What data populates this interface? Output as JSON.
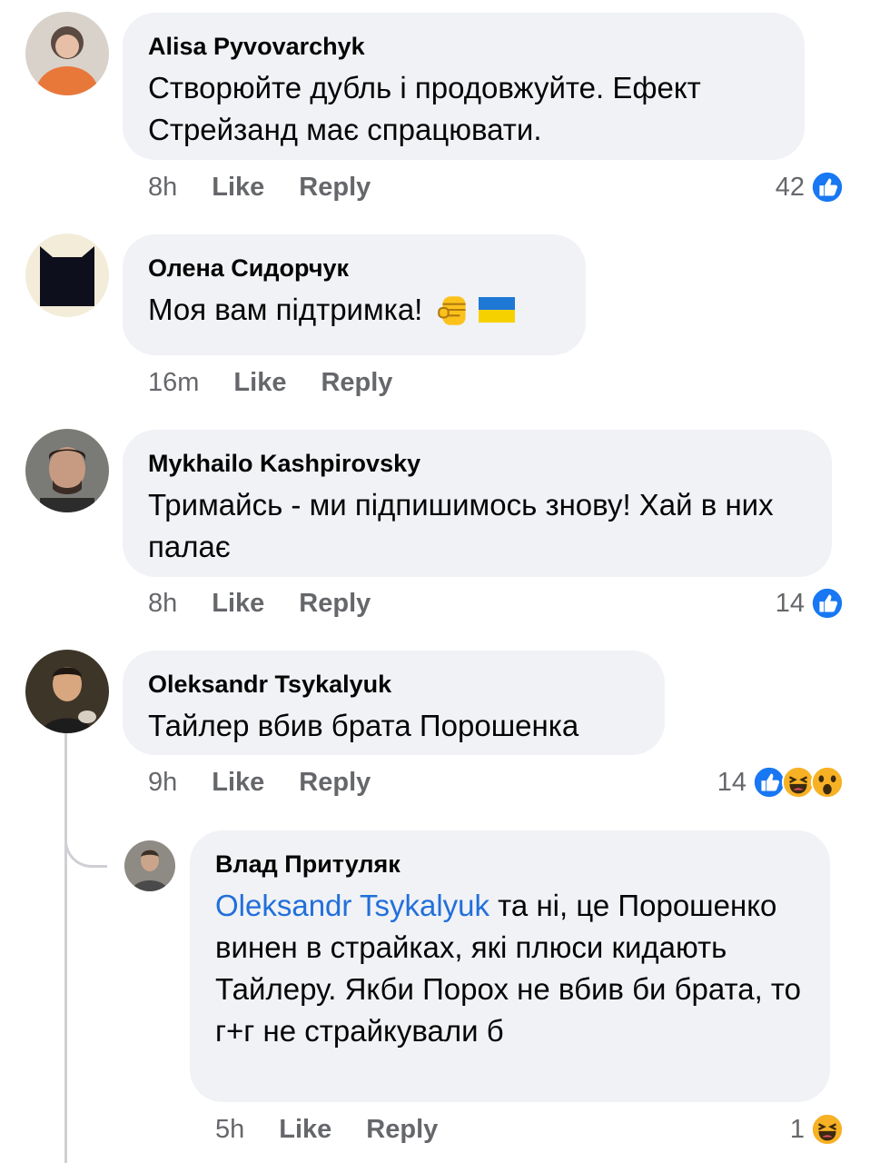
{
  "comments": [
    {
      "author": "Alisa Pyvovarchyk",
      "text": "Створюйте дубль і продовжуйте. Ефект Стрейзанд має спрацювати.",
      "time": "8h",
      "like_label": "Like",
      "reply_label": "Reply",
      "reactions_count": "42",
      "reactions": [
        "like-icon"
      ]
    },
    {
      "author": "Олена Сидорчук",
      "text": "Моя вам підтримка!",
      "emoji": [
        "raised-fist-icon",
        "ukraine-flag-icon"
      ],
      "time": "16m",
      "like_label": "Like",
      "reply_label": "Reply"
    },
    {
      "author": "Mykhailo Kashpirovsky",
      "text": "Тримайсь - ми підпишимось знову! Хай в них палає",
      "time": "8h",
      "like_label": "Like",
      "reply_label": "Reply",
      "reactions_count": "14",
      "reactions": [
        "like-icon"
      ]
    },
    {
      "author": "Oleksandr Tsykalyuk",
      "text": "Тайлер вбив брата Порошенка",
      "time": "9h",
      "like_label": "Like",
      "reply_label": "Reply",
      "reactions_count": "14",
      "reactions": [
        "like-icon",
        "haha-icon",
        "wow-icon"
      ]
    }
  ],
  "reply": {
    "author": "Влад Притуляк",
    "mention": "Oleksandr Tsykalyuk",
    "text": " та ні, це Порошенко винен в страйках, які плюси кидають Тайлеру. Якби Порох не вбив би брата, то г+г не страйкували б",
    "time": "5h",
    "like_label": "Like",
    "reply_label": "Reply",
    "reactions_count": "1",
    "reactions": [
      "haha-icon"
    ]
  },
  "colors": {
    "bubble": "#f0f2f5",
    "meta": "#65676b",
    "mention": "#216fdb",
    "like_blue": "#1877f2",
    "haha_yellow": "#f7b125"
  }
}
